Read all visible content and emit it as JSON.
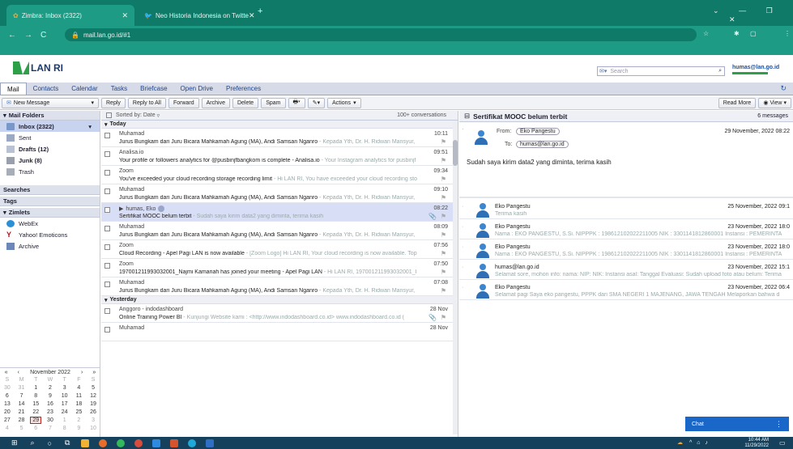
{
  "browser": {
    "tabs": [
      {
        "title": "Zimbra: Inbox (2322)",
        "active": true
      },
      {
        "title": "Neo Historia Indonesia on Twitte",
        "active": false
      }
    ],
    "new_tab": "+",
    "url": "mail.lan.go.id/#1"
  },
  "zimbra": {
    "logo": "LAN RI",
    "search_placeholder": "Search",
    "user": "humas@lan.go.id",
    "apps": [
      "Mail",
      "Contacts",
      "Calendar",
      "Tasks",
      "Briefcase",
      "Open Drive",
      "Preferences"
    ],
    "toolbar": {
      "new_message": "New Message",
      "reply": "Reply",
      "reply_all": "Reply to All",
      "forward": "Forward",
      "archive": "Archive",
      "delete": "Delete",
      "spam": "Spam",
      "actions": "Actions",
      "read_more": "Read More",
      "view": "View"
    },
    "sidebar": {
      "mail_folders": "Mail Folders",
      "folders": [
        {
          "label": "Inbox (2322)",
          "bold": true,
          "selected": true
        },
        {
          "label": "Sent",
          "bold": false
        },
        {
          "label": "Drafts (12)",
          "bold": true
        },
        {
          "label": "Junk (8)",
          "bold": true
        },
        {
          "label": "Trash",
          "bold": false
        }
      ],
      "searches": "Searches",
      "tags": "Tags",
      "zimlets": "Zimlets",
      "zimlet_items": [
        "WebEx",
        "Yahoo! Emoticons",
        "Archive"
      ]
    },
    "calendar": {
      "month": "November 2022",
      "weekdays": [
        "S",
        "M",
        "T",
        "W",
        "T",
        "F",
        "S"
      ],
      "weeks": [
        [
          "30",
          "31",
          "1",
          "2",
          "3",
          "4",
          "5"
        ],
        [
          "6",
          "7",
          "8",
          "9",
          "10",
          "11",
          "12"
        ],
        [
          "13",
          "14",
          "15",
          "16",
          "17",
          "18",
          "19"
        ],
        [
          "20",
          "21",
          "22",
          "23",
          "24",
          "25",
          "26"
        ],
        [
          "27",
          "28",
          "29",
          "30",
          "1",
          "2",
          "3"
        ],
        [
          "4",
          "5",
          "6",
          "7",
          "8",
          "9",
          "10"
        ]
      ]
    },
    "list": {
      "sort": "Sorted by: Date",
      "count": "100+ conversations",
      "groups": {
        "today": "Today",
        "yesterday": "Yesterday"
      },
      "messages": [
        {
          "from": "Muhamad",
          "time": "10:11",
          "subject": "Jurus Bungkam dari Juru Bicara Mahkamah Agung (MA), Andi Samsan Nganro",
          "fragment": " - Kepada Yth, Dr. H. Ridwan Mansyur,"
        },
        {
          "from": "Analisa.io",
          "time": "09:51",
          "subject": "Your profile or followers analytics for @pusbinjfbangkom is complete - Analisa.io",
          "fragment": " - Your Instagram analytics for pusbinjf"
        },
        {
          "from": "Zoom",
          "time": "09:34",
          "subject": "You've exceeded your cloud recording storage recording limit",
          "fragment": " - Hi LAN RI, You have exceeded your cloud recording sto"
        },
        {
          "from": "Muhamad",
          "time": "09:10",
          "subject": "Jurus Bungkam dari Juru Bicara Mahkamah Agung (MA), Andi Samsan Nganro",
          "fragment": " - Kepada Yth, Dr. H. Ridwan Mansyur,"
        },
        {
          "from": "humas, Eko",
          "time": "08:22",
          "subject": "Sertifikat MOOC belum terbit",
          "fragment": " - Sudah saya kirim data2 yang diminta, terima kasih"
        },
        {
          "from": "Muhamad",
          "time": "08:09",
          "subject": "Jurus Bungkam dari Juru Bicara Mahkamah Agung (MA), Andi Samsan Nganro",
          "fragment": " - Kepada Yth, Dr. H. Ridwan Mansyur,"
        },
        {
          "from": "Zoom",
          "time": "07:56",
          "subject": "Cloud Recording - Apel Pagi LAN is now available",
          "fragment": " - [Zoom Logo] Hi LAN RI, Your cloud recording is now available. Top"
        },
        {
          "from": "Zoom",
          "time": "07:50",
          "subject": "197001211993032001_Najmi Kamariah has joined your meeting - Apel Pagi LAN",
          "fragment": " - Hi LAN RI, 197001211993032001_I"
        },
        {
          "from": "Muhamad",
          "time": "07:08",
          "subject": "Jurus Bungkam dari Juru Bicara Mahkamah Agung (MA), Andi Samsan Nganro",
          "fragment": " - Kepada Yth, Dr. H. Ridwan Mansyur,"
        },
        {
          "from": "Anggoro - indodashboard",
          "time": "28 Nov",
          "subject": "Online Training Power BI",
          "fragment": " - Kunjungi Website kami : <http://www.indodashboard.co.id> www.indodashboard.co.id ("
        },
        {
          "from": "Muhamad",
          "time": "28 Nov",
          "subject": "",
          "fragment": ""
        }
      ]
    },
    "reading": {
      "subject": "Sertifikat MOOC belum terbit",
      "count": "6 messages",
      "from_label": "From:",
      "from": "Eko Pangestu",
      "to_label": "To:",
      "to": "humas@lan.go.id",
      "date": "29 November, 2022 08:22",
      "body": "Sudah saya kirim data2 yang diminta, terima kasih",
      "thread": [
        {
          "name": "Eko Pangestu",
          "date": "25 November, 2022 09:1",
          "fragment": "Terima kasih"
        },
        {
          "name": "Eko Pangestu",
          "date": "23 November, 2022 18:0",
          "fragment": "Nama : EKO PANGESTU, S.Si. NIPPPK : 198612102022211005 NIK : 3301141812860001 Instansi : PEMERINTA"
        },
        {
          "name": "Eko Pangestu",
          "date": "23 November, 2022 18:0",
          "fragment": "Nama : EKO PANGESTU, S.Si. NIPPPK : 198612102022211005 NIK : 3301141812860001 Instansi : PEMERINTA"
        },
        {
          "name": "humas@lan.go.id",
          "date": "23 November, 2022 15:1",
          "fragment": "Selamat sore, mohon info: nama: NIP: NIK: Instansi asal: Tanggal Evaluasi: Sudah upload foto atau belum: Terima"
        },
        {
          "name": "Eko Pangestu",
          "date": "23 November, 2022 06:4",
          "fragment": "Selamat pagi Saya eko pangestu, PPPK dari SMA NEGERI 1 MAJENANG, JAWA TENGAH Melaporkan bahwa d"
        }
      ]
    },
    "chat": "Chat"
  },
  "taskbar": {
    "time": "10:44 AM",
    "date": "11/29/2022"
  }
}
